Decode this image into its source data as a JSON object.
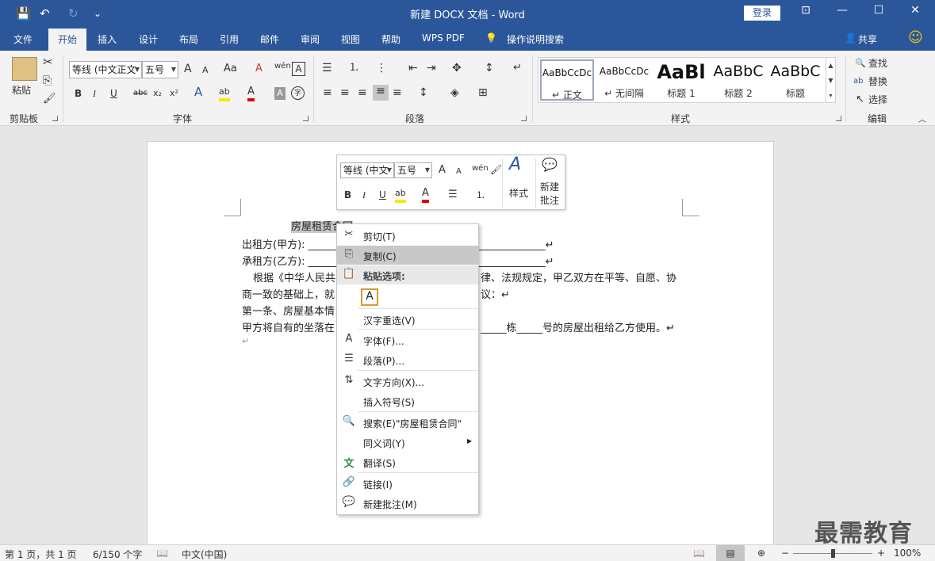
{
  "titlebar": {
    "title": "新建 DOCX 文档  -  Word",
    "login": "登录",
    "save_icon": "💾",
    "undo_icon": "↶",
    "redo_icon": "↻",
    "qa_icon": "⌄",
    "ribbon_opt_icon": "⊡",
    "min_icon": "—",
    "max_icon": "☐",
    "close_icon": "✕"
  },
  "tabs": [
    "文件",
    "开始",
    "插入",
    "设计",
    "布局",
    "引用",
    "邮件",
    "审阅",
    "视图",
    "帮助",
    "WPS PDF"
  ],
  "tell_me": "操作说明搜索",
  "tell_me_icon": "💡",
  "share": "共享",
  "share_icon": "👤",
  "smile_icon": "☺",
  "ribbon": {
    "clipboard": {
      "label": "剪贴板",
      "paste": "粘贴",
      "cut_icon": "✂",
      "copy_icon": "⎘",
      "painter_icon": "🖌"
    },
    "font": {
      "label": "字体",
      "font_name": "等线 (中文正文",
      "font_size": "五号",
      "grow": "A",
      "shrink": "A",
      "aa": "Aa",
      "clear": "A",
      "pinyin": "wén",
      "border_a": "A",
      "bold": "B",
      "italic": "I",
      "underline": "U",
      "strike": "abc",
      "sub": "x₂",
      "sup": "x²",
      "effects": "A",
      "highlight": "ab",
      "color": "A",
      "shade": "A",
      "circle": "字"
    },
    "paragraph": {
      "label": "段落",
      "bullets": "☰",
      "numbering": "⒈",
      "multilevel": "⋮",
      "dec_indent": "⇤",
      "inc_indent": "⇥",
      "chinese_layout": "✥",
      "sort": "↕",
      "marks": "↵",
      "al_left": "≡",
      "al_center": "≡",
      "al_right": "≡",
      "justify": "≡",
      "distribute": "≡",
      "spacing": "↕",
      "shading": "◈",
      "borders": "⊞"
    },
    "styles": {
      "label": "样式",
      "items": [
        {
          "preview": "AaBbCcDc",
          "name": "↵ 正文"
        },
        {
          "preview": "AaBbCcDc",
          "name": "↵ 无间隔"
        },
        {
          "preview": "AaBl",
          "name": "标题 1"
        },
        {
          "preview": "AaBbC",
          "name": "标题 2"
        },
        {
          "preview": "AaBbC",
          "name": "标题"
        }
      ]
    },
    "editing": {
      "label": "编辑",
      "find": "查找",
      "replace": "替换",
      "select": "选择",
      "find_icon": "🔍",
      "replace_icon": "ab",
      "select_icon": "↖"
    }
  },
  "document": {
    "title_line": "房屋租赁合同",
    "lines": [
      "出租方(甲方): ______________________________________________↵",
      "承租方(乙方): ______________________________________________↵",
      "根据《中华人民共",
      "律、法规规定，甲乙双方在平等、自愿、协",
      "商一致的基础上，就",
      "议：↵",
      "第一条、房屋基本情",
      "甲方将自有的坐落在",
      "_____栋_____号的房屋出租给乙方使用。↵",
      "↵"
    ]
  },
  "minitoolbar": {
    "font": "等线 (中文",
    "size": "五号",
    "grow": "A",
    "shrink": "A",
    "pinyin": "wén",
    "painter": "🖌",
    "bold": "B",
    "italic": "I",
    "underline": "U",
    "highlight": "ab",
    "color": "A",
    "bullets": "☰",
    "numbering": "⒈",
    "styles": "样式",
    "styles_icon": "A",
    "comment_label1": "新建",
    "comment_label2": "批注",
    "comment_icon": "💬"
  },
  "context_menu": [
    {
      "icon": "✂",
      "label": "剪切(T)"
    },
    {
      "icon": "⎘",
      "label": "复制(C)"
    },
    {
      "icon": "📋",
      "label": "粘贴选项:"
    },
    {
      "icon": "A",
      "label": ""
    },
    {
      "icon": "",
      "label": "汉字重选(V)"
    },
    {
      "icon": "A",
      "label": "字体(F)..."
    },
    {
      "icon": "☰",
      "label": "段落(P)..."
    },
    {
      "icon": "⇅",
      "label": "文字方向(X)..."
    },
    {
      "icon": "",
      "label": "插入符号(S)"
    },
    {
      "icon": "🔍",
      "label": "搜索(E)\"房屋租赁合同\""
    },
    {
      "icon": "",
      "label": "同义词(Y)"
    },
    {
      "icon": "文",
      "label": "翻译(S)"
    },
    {
      "icon": "🔗",
      "label": "链接(I)"
    },
    {
      "icon": "💬",
      "label": "新建批注(M)"
    }
  ],
  "status": {
    "page": "第 1 页，共 1 页",
    "words": "6/150 个字",
    "lang": "中文(中国)",
    "zoom": "100%",
    "zoom_minus": "−",
    "zoom_plus": "+",
    "proof_icon": "📖",
    "read_icon": "📖",
    "print_icon": "▤",
    "web_icon": "⊕"
  },
  "watermark": "最需教育"
}
